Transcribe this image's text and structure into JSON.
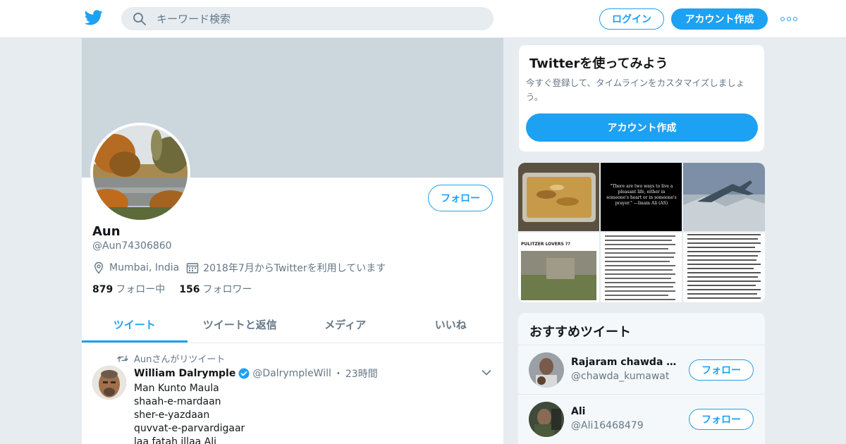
{
  "header": {
    "search_placeholder": "キーワード検索",
    "login_label": "ログイン",
    "signup_label": "アカウント作成",
    "accent_color": "#1da1f2"
  },
  "profile": {
    "follow_label": "フォロー",
    "name": "Aun",
    "handle": "@Aun74306860",
    "location": "Mumbai, India",
    "joined": "2018年7月からTwitterを利用しています",
    "following_count": "879",
    "following_label": "フォロー中",
    "followers_count": "156",
    "followers_label": "フォロワー"
  },
  "tabs": [
    {
      "label": "ツイート",
      "active": true
    },
    {
      "label": "ツイートと返信",
      "active": false
    },
    {
      "label": "メディア",
      "active": false
    },
    {
      "label": "いいね",
      "active": false
    }
  ],
  "tweet": {
    "retweet_note": "Aunさんがリツイート",
    "author_name": "William Dalrymple",
    "author_handle": "@DalrympleWill",
    "separator": "・",
    "time": "23時間",
    "lines": [
      "Man Kunto Maula",
      "shaah-e-mardaan",
      "sher-e-yazdaan",
      "quvvat-e-parvardigaar",
      "laa fatah illaa Ali"
    ]
  },
  "signup_card": {
    "title": "Twitterを使ってみよう",
    "description": "今すぐ登録して、タイムラインをカスタマイズしましょう。",
    "button_label": "アカウント作成"
  },
  "media": {
    "quote_text": "\"There are two ways to live a pleasant life, either in someone's heart or in someone's prayer.\" —Imam Ali (AS)",
    "pulitzer_text": "PULITZER LOVERS ??"
  },
  "recommendations": {
    "title": "おすすめツイート",
    "follow_label": "フォロー",
    "items": [
      {
        "name": "Rajaram chawda Ku...",
        "handle": "@chawda_kumawat"
      },
      {
        "name": "Ali",
        "handle": "@Ali16468479"
      }
    ]
  }
}
